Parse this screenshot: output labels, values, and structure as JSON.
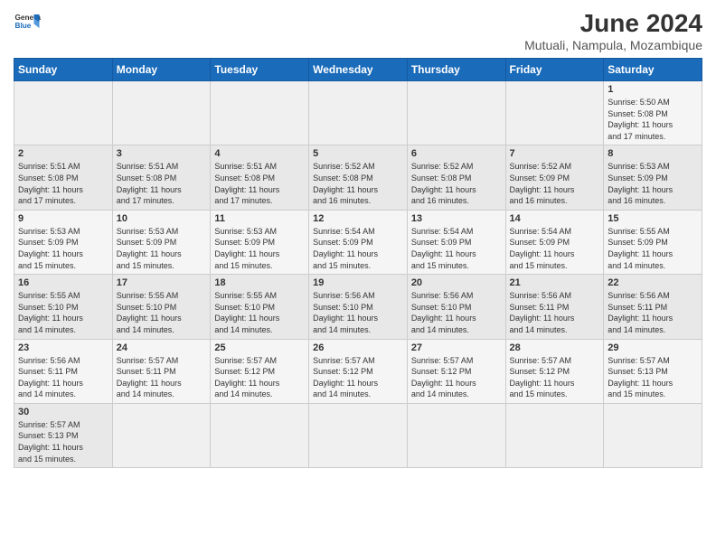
{
  "header": {
    "logo_line1": "General",
    "logo_line2": "Blue",
    "title": "June 2024",
    "subtitle": "Mutuali, Nampula, Mozambique"
  },
  "days_of_week": [
    "Sunday",
    "Monday",
    "Tuesday",
    "Wednesday",
    "Thursday",
    "Friday",
    "Saturday"
  ],
  "weeks": [
    [
      {
        "day": "",
        "info": ""
      },
      {
        "day": "",
        "info": ""
      },
      {
        "day": "",
        "info": ""
      },
      {
        "day": "",
        "info": ""
      },
      {
        "day": "",
        "info": ""
      },
      {
        "day": "",
        "info": ""
      },
      {
        "day": "1",
        "info": "Sunrise: 5:50 AM\nSunset: 5:08 PM\nDaylight: 11 hours\nand 17 minutes."
      }
    ],
    [
      {
        "day": "2",
        "info": "Sunrise: 5:51 AM\nSunset: 5:08 PM\nDaylight: 11 hours\nand 17 minutes."
      },
      {
        "day": "3",
        "info": "Sunrise: 5:51 AM\nSunset: 5:08 PM\nDaylight: 11 hours\nand 17 minutes."
      },
      {
        "day": "4",
        "info": "Sunrise: 5:51 AM\nSunset: 5:08 PM\nDaylight: 11 hours\nand 17 minutes."
      },
      {
        "day": "5",
        "info": "Sunrise: 5:52 AM\nSunset: 5:08 PM\nDaylight: 11 hours\nand 16 minutes."
      },
      {
        "day": "6",
        "info": "Sunrise: 5:52 AM\nSunset: 5:08 PM\nDaylight: 11 hours\nand 16 minutes."
      },
      {
        "day": "7",
        "info": "Sunrise: 5:52 AM\nSunset: 5:09 PM\nDaylight: 11 hours\nand 16 minutes."
      },
      {
        "day": "8",
        "info": "Sunrise: 5:53 AM\nSunset: 5:09 PM\nDaylight: 11 hours\nand 16 minutes."
      }
    ],
    [
      {
        "day": "9",
        "info": "Sunrise: 5:53 AM\nSunset: 5:09 PM\nDaylight: 11 hours\nand 15 minutes."
      },
      {
        "day": "10",
        "info": "Sunrise: 5:53 AM\nSunset: 5:09 PM\nDaylight: 11 hours\nand 15 minutes."
      },
      {
        "day": "11",
        "info": "Sunrise: 5:53 AM\nSunset: 5:09 PM\nDaylight: 11 hours\nand 15 minutes."
      },
      {
        "day": "12",
        "info": "Sunrise: 5:54 AM\nSunset: 5:09 PM\nDaylight: 11 hours\nand 15 minutes."
      },
      {
        "day": "13",
        "info": "Sunrise: 5:54 AM\nSunset: 5:09 PM\nDaylight: 11 hours\nand 15 minutes."
      },
      {
        "day": "14",
        "info": "Sunrise: 5:54 AM\nSunset: 5:09 PM\nDaylight: 11 hours\nand 15 minutes."
      },
      {
        "day": "15",
        "info": "Sunrise: 5:55 AM\nSunset: 5:09 PM\nDaylight: 11 hours\nand 14 minutes."
      }
    ],
    [
      {
        "day": "16",
        "info": "Sunrise: 5:55 AM\nSunset: 5:10 PM\nDaylight: 11 hours\nand 14 minutes."
      },
      {
        "day": "17",
        "info": "Sunrise: 5:55 AM\nSunset: 5:10 PM\nDaylight: 11 hours\nand 14 minutes."
      },
      {
        "day": "18",
        "info": "Sunrise: 5:55 AM\nSunset: 5:10 PM\nDaylight: 11 hours\nand 14 minutes."
      },
      {
        "day": "19",
        "info": "Sunrise: 5:56 AM\nSunset: 5:10 PM\nDaylight: 11 hours\nand 14 minutes."
      },
      {
        "day": "20",
        "info": "Sunrise: 5:56 AM\nSunset: 5:10 PM\nDaylight: 11 hours\nand 14 minutes."
      },
      {
        "day": "21",
        "info": "Sunrise: 5:56 AM\nSunset: 5:11 PM\nDaylight: 11 hours\nand 14 minutes."
      },
      {
        "day": "22",
        "info": "Sunrise: 5:56 AM\nSunset: 5:11 PM\nDaylight: 11 hours\nand 14 minutes."
      }
    ],
    [
      {
        "day": "23",
        "info": "Sunrise: 5:56 AM\nSunset: 5:11 PM\nDaylight: 11 hours\nand 14 minutes."
      },
      {
        "day": "24",
        "info": "Sunrise: 5:57 AM\nSunset: 5:11 PM\nDaylight: 11 hours\nand 14 minutes."
      },
      {
        "day": "25",
        "info": "Sunrise: 5:57 AM\nSunset: 5:12 PM\nDaylight: 11 hours\nand 14 minutes."
      },
      {
        "day": "26",
        "info": "Sunrise: 5:57 AM\nSunset: 5:12 PM\nDaylight: 11 hours\nand 14 minutes."
      },
      {
        "day": "27",
        "info": "Sunrise: 5:57 AM\nSunset: 5:12 PM\nDaylight: 11 hours\nand 14 minutes."
      },
      {
        "day": "28",
        "info": "Sunrise: 5:57 AM\nSunset: 5:12 PM\nDaylight: 11 hours\nand 15 minutes."
      },
      {
        "day": "29",
        "info": "Sunrise: 5:57 AM\nSunset: 5:13 PM\nDaylight: 11 hours\nand 15 minutes."
      }
    ],
    [
      {
        "day": "30",
        "info": "Sunrise: 5:57 AM\nSunset: 5:13 PM\nDaylight: 11 hours\nand 15 minutes."
      },
      {
        "day": "",
        "info": ""
      },
      {
        "day": "",
        "info": ""
      },
      {
        "day": "",
        "info": ""
      },
      {
        "day": "",
        "info": ""
      },
      {
        "day": "",
        "info": ""
      },
      {
        "day": "",
        "info": ""
      }
    ]
  ]
}
